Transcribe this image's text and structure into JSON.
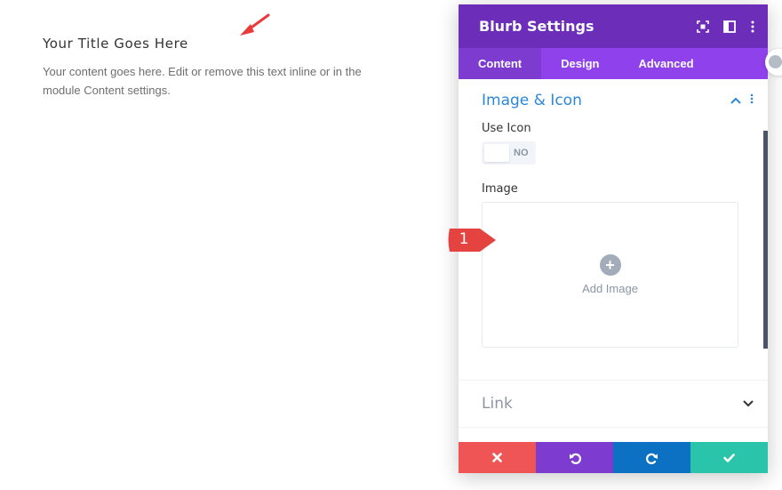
{
  "preview": {
    "title": "Your Title Goes Here",
    "content": "Your content goes here. Edit or remove this text inline or in the module Content settings."
  },
  "modal": {
    "title": "Blurb Settings",
    "tabs": [
      {
        "label": "Content",
        "active": true
      },
      {
        "label": "Design",
        "active": false
      },
      {
        "label": "Advanced",
        "active": false
      }
    ],
    "sections": {
      "image_icon": {
        "title": "Image & Icon",
        "use_icon_label": "Use Icon",
        "use_icon_value": "NO",
        "image_label": "Image",
        "add_image_label": "Add Image",
        "add_image_symbol": "+"
      },
      "link": {
        "title": "Link"
      }
    },
    "footer": {
      "cancel_icon": "close-icon",
      "undo_icon": "undo-icon",
      "redo_icon": "redo-icon",
      "save_icon": "check-icon"
    }
  },
  "annotation": {
    "number": "1"
  },
  "colors": {
    "header": "#6c2eb9",
    "tabs": "#8f42ec",
    "active_tab": "#7e3bd0",
    "section_title": "#2b87da",
    "cancel": "#ef5555",
    "undo": "#7e3bd0",
    "redo": "#0c71c3",
    "save": "#29c4a9",
    "marker": "#e4433f"
  }
}
